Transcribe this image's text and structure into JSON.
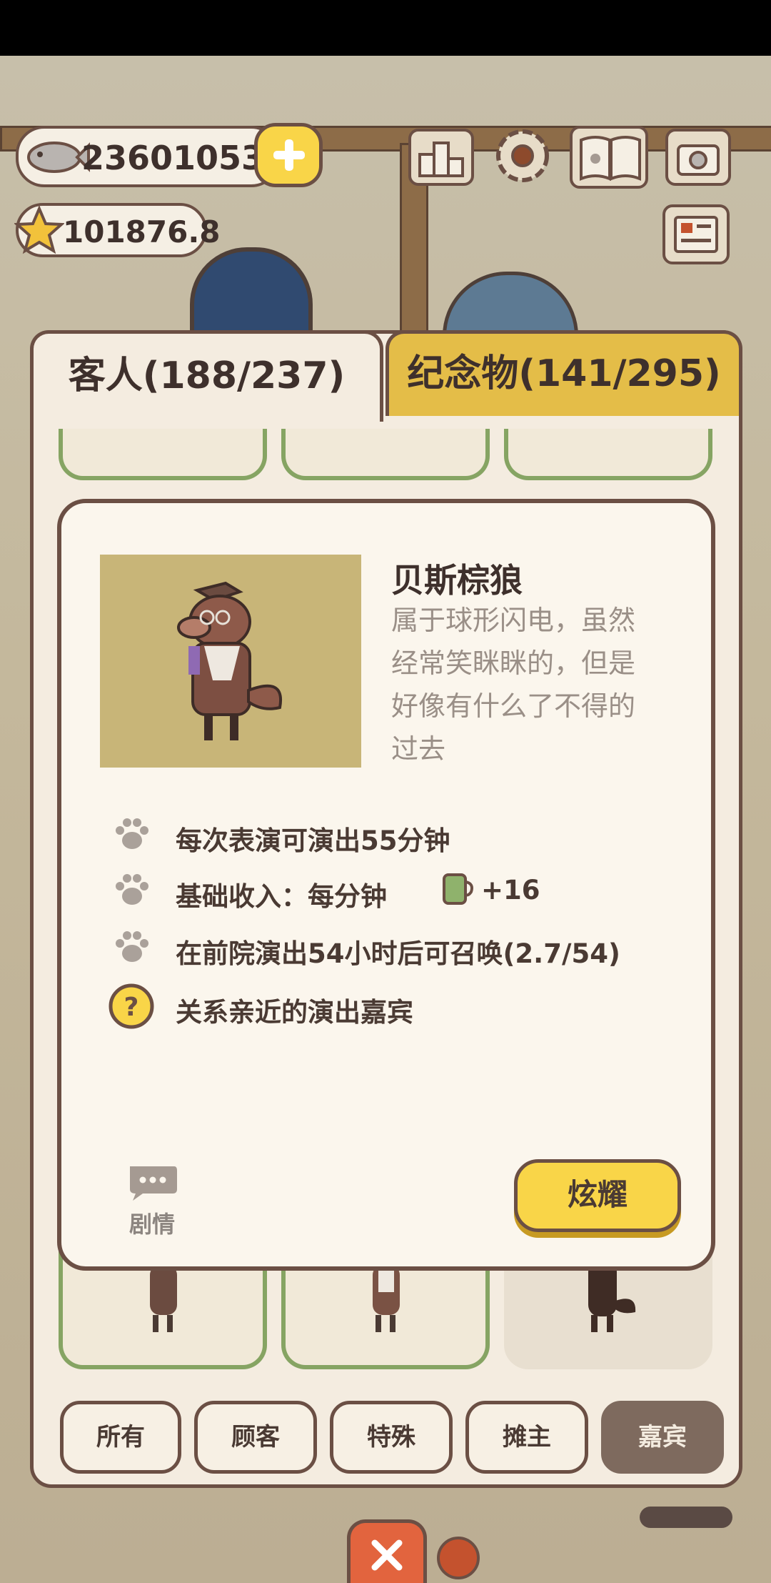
{
  "resources": {
    "fish_count": "23601053",
    "star_count": "101876.8"
  },
  "icons": {
    "fish": "fish-icon",
    "star": "star-icon",
    "add": "plus-icon",
    "leaderboard": "podium-icon",
    "settings": "gear-icon",
    "book": "paw-book-icon",
    "camera": "camera-icon",
    "newspaper": "newspaper-icon",
    "paw": "paw-icon",
    "question": "question-icon",
    "chat": "chat-bubble-icon",
    "close": "close-icon",
    "income": "drink-cup-icon"
  },
  "tabs": {
    "guests": "客人(188/237)",
    "souvenirs": "纪念物(141/295)"
  },
  "character": {
    "name": "贝斯棕狼",
    "description_lines": [
      "属于球形闪电，虽然",
      "经常笑眯眯的，但是",
      "好像有什么了不得的",
      "过去"
    ],
    "stats": {
      "duration": "每次表演可演出55分钟",
      "income_label": "基础收入：每分钟",
      "income_value": "+16",
      "summon": "在前院演出54小时后可召唤(2.7/54)",
      "relation": "关系亲近的演出嘉宾"
    }
  },
  "buttons": {
    "story": "剧情",
    "flaunt": "炫耀"
  },
  "filters": [
    "所有",
    "顾客",
    "特殊",
    "摊主",
    "嘉宾"
  ],
  "colors": {
    "accent_yellow": "#f9d548",
    "tab_active_bg": "#f4ece0",
    "tab_inactive_bg": "#e4bd48",
    "card_border": "#86a463",
    "filter_active_bg": "#7e6a5e",
    "portrait_bg": "#c8b578"
  }
}
